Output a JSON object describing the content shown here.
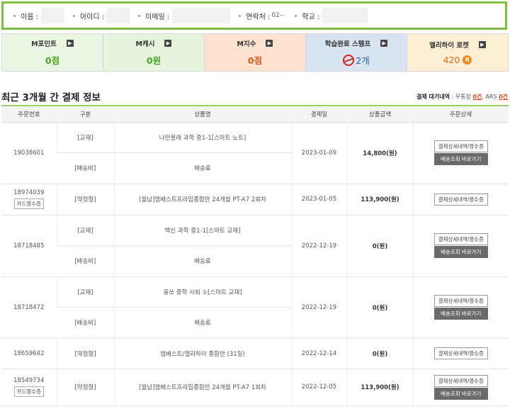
{
  "profile": {
    "name_label": "이름 :",
    "id_label": "아이디 :",
    "email_label": "이메일 :",
    "phone_label": "연락처 :",
    "phone_value": "02--",
    "school_label": "학교 :"
  },
  "stats": [
    {
      "label": "M포인트",
      "value": "0점"
    },
    {
      "label": "M캐시",
      "value": "0원"
    },
    {
      "label": "M지수",
      "value": "0점"
    },
    {
      "label": "학습완료 스탬프",
      "value": "2개"
    },
    {
      "label": "엘리하이 로켓",
      "value": "420",
      "coin": "R"
    }
  ],
  "arrow_glyph": "▶",
  "section": {
    "title": "최근 3개월 간 결제 정보",
    "pending_label": "결제 대기내역",
    "pending_text1": " : 무통장 ",
    "pending_count1": "0건",
    "pending_text2": ", ARS ",
    "pending_count2": "0건"
  },
  "table": {
    "headers": [
      "주문번호",
      "구분",
      "상품명",
      "결제일",
      "상품금액",
      "주문상세"
    ],
    "detail_button": "결제상세내역/영수증",
    "ship_button": "배송조회 바로가기",
    "receipt_label": "카드영수증",
    "orders": [
      {
        "no": "19038601",
        "date": "2023-01-09",
        "amount": "14,800(원)",
        "items": [
          {
            "type": "[교재]",
            "name": "나만볼래 과학 중1-1[스마트 노트]"
          },
          {
            "type": "[배송비]",
            "name": "배송료"
          }
        ]
      },
      {
        "no": "18974039",
        "date": "2023-01-05",
        "amount": "113,900(원)",
        "items": [
          {
            "type": "[약정형]",
            "name": "[월납]엠베스트프라임종합반 24개월 PT-A7 2회차"
          }
        ]
      },
      {
        "no": "18718485",
        "date": "2022-12-19",
        "amount": "0(원)",
        "items": [
          {
            "type": "[교재]",
            "name": "백신 과학 중1-1[스마트 교재]"
          },
          {
            "type": "[배송비]",
            "name": "배송료"
          }
        ]
      },
      {
        "no": "18718472",
        "date": "2022-12-19",
        "amount": "0(원)",
        "items": [
          {
            "type": "[교재]",
            "name": "홈쏘 중학 사회 ①[스마트 교재]"
          },
          {
            "type": "[배송비]",
            "name": "배송료"
          }
        ]
      },
      {
        "no": "18659642",
        "date": "2022-12-14",
        "amount": "0(원)",
        "items": [
          {
            "type": "[약정형]",
            "name": "엠베스트/엘리하이 종합반 (31일)"
          }
        ]
      },
      {
        "no": "18549734",
        "date": "2022-12-05",
        "amount": "113,900(원)",
        "items": [
          {
            "type": "[약정형]",
            "name": "[월납]엠베스트프라임종합반 24개월 PT-A7 1회차"
          }
        ]
      }
    ]
  }
}
